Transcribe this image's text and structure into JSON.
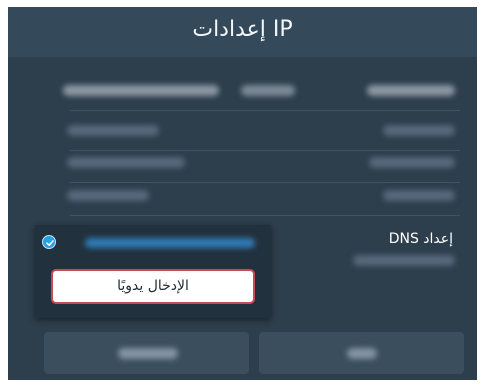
{
  "header": {
    "title": "إعدادات IP"
  },
  "dns_setting": {
    "label": "إعداد DNS"
  },
  "dns_dropdown": {
    "manual_option": "الإدخال يدويًا"
  },
  "colors": {
    "background": "#2d3e4c",
    "title_bar": "#34495a",
    "dropdown_bg": "#22313e",
    "focus_border": "#c84a55",
    "selected_check": "#2b9fe0"
  },
  "icons": {
    "selected_option": "check-circle-icon"
  }
}
